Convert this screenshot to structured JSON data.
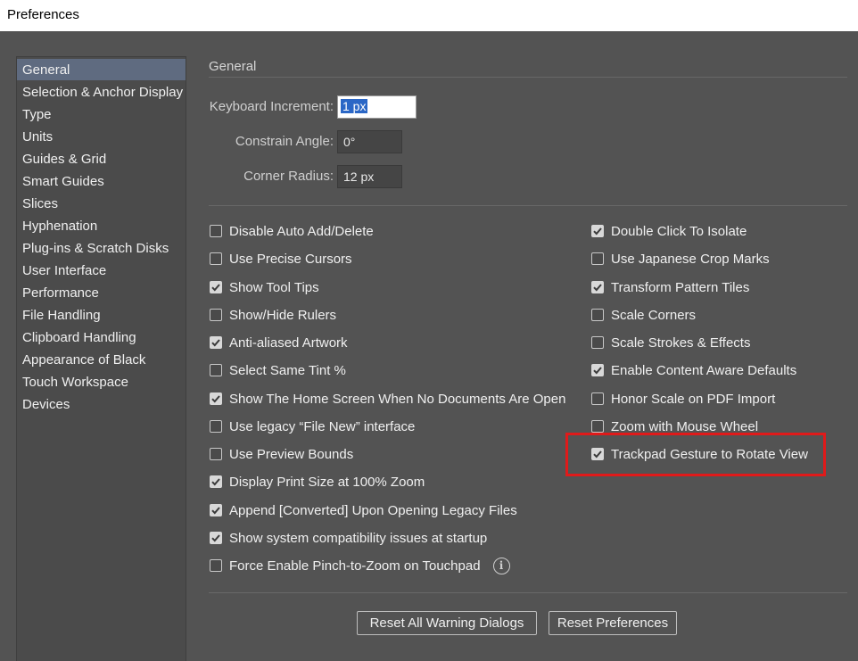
{
  "window": {
    "title": "Preferences"
  },
  "sidebar": {
    "items": [
      {
        "label": "General",
        "active": true
      },
      {
        "label": "Selection & Anchor Display"
      },
      {
        "label": "Type"
      },
      {
        "label": "Units"
      },
      {
        "label": "Guides & Grid"
      },
      {
        "label": "Smart Guides"
      },
      {
        "label": "Slices"
      },
      {
        "label": "Hyphenation"
      },
      {
        "label": "Plug-ins & Scratch Disks"
      },
      {
        "label": "User Interface"
      },
      {
        "label": "Performance"
      },
      {
        "label": "File Handling"
      },
      {
        "label": "Clipboard Handling"
      },
      {
        "label": "Appearance of Black"
      },
      {
        "label": "Touch Workspace"
      },
      {
        "label": "Devices"
      }
    ]
  },
  "main": {
    "section_title": "General",
    "fields": {
      "keyboard_increment": {
        "label": "Keyboard Increment:",
        "value": "1 px"
      },
      "constrain_angle": {
        "label": "Constrain Angle:",
        "value": "0°"
      },
      "corner_radius": {
        "label": "Corner Radius:",
        "value": "12 px"
      }
    },
    "left_options": [
      {
        "label": "Disable Auto Add/Delete",
        "checked": false
      },
      {
        "label": "Use Precise Cursors",
        "checked": false
      },
      {
        "label": "Show Tool Tips",
        "checked": true
      },
      {
        "label": "Show/Hide Rulers",
        "checked": false
      },
      {
        "label": "Anti-aliased Artwork",
        "checked": true
      },
      {
        "label": "Select Same Tint %",
        "checked": false
      },
      {
        "label": "Show The Home Screen When No Documents Are Open",
        "checked": true
      },
      {
        "label": "Use legacy “File New” interface",
        "checked": false
      },
      {
        "label": "Use Preview Bounds",
        "checked": false
      },
      {
        "label": "Display Print Size at 100% Zoom",
        "checked": true
      },
      {
        "label": "Append [Converted] Upon Opening Legacy Files",
        "checked": true
      },
      {
        "label": "Show system compatibility issues at startup",
        "checked": true
      },
      {
        "label": "Force Enable Pinch-to-Zoom on Touchpad",
        "checked": false,
        "info_icon": "info-icon"
      }
    ],
    "right_options": [
      {
        "label": "Double Click To Isolate",
        "checked": true
      },
      {
        "label": "Use Japanese Crop Marks",
        "checked": false
      },
      {
        "label": "Transform Pattern Tiles",
        "checked": true
      },
      {
        "label": "Scale Corners",
        "checked": false
      },
      {
        "label": "Scale Strokes & Effects",
        "checked": false
      },
      {
        "label": "Enable Content Aware Defaults",
        "checked": true
      },
      {
        "label": "Honor Scale on PDF Import",
        "checked": false
      },
      {
        "label": "Zoom with Mouse Wheel",
        "checked": false
      },
      {
        "label": "Trackpad Gesture to Rotate View",
        "checked": true,
        "highlighted": true
      }
    ],
    "buttons": {
      "reset_warnings": "Reset All Warning Dialogs",
      "reset_preferences": "Reset Preferences"
    }
  },
  "colors": {
    "panel_bg": "#535353",
    "sidebar_bg": "#4b4b4b",
    "active_item": "#5f6b80",
    "highlight_box": "#e01a1a",
    "focus_selection": "#2b67c6"
  }
}
